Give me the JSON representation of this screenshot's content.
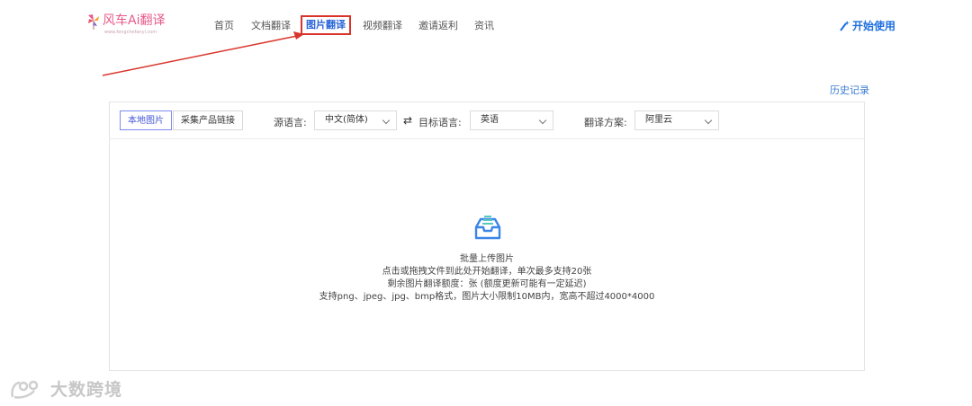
{
  "header": {
    "logo_text": "风车Ai翻译",
    "logo_sub": "www.fengchefanyi.com",
    "nav": [
      {
        "label": "首页",
        "active": false
      },
      {
        "label": "文档翻译",
        "active": false
      },
      {
        "label": "图片翻译",
        "active": true
      },
      {
        "label": "视频翻译",
        "active": false
      },
      {
        "label": "邀请返利",
        "active": false
      },
      {
        "label": "资讯",
        "active": false
      }
    ],
    "start_label": "开始使用",
    "start_icon": "magic-wand-icon"
  },
  "history_label": "历史记录",
  "toolbar": {
    "tabs": [
      {
        "label": "本地图片",
        "active": true
      },
      {
        "label": "采集产品链接",
        "active": false
      }
    ],
    "source_label": "源语言:",
    "source_value": "中文(简体)",
    "swap_icon": "⇄",
    "target_label": "目标语言:",
    "target_value": "英语",
    "plan_label": "翻译方案:",
    "plan_value": "阿里云"
  },
  "dropzone": {
    "icon": "inbox-upload-icon",
    "title": "批量上传图片",
    "line1": "点击或拖拽文件到此处开始翻译，单次最多支持20张",
    "line2": "剩余图片翻译额度：张 (额度更新可能有一定延迟)",
    "line3": "支持png、jpeg、jpg、bmp格式，图片大小限制10MB内，宽高不超过4000*4000"
  },
  "watermark_text": "大数跨境",
  "colors": {
    "accent": "#1f6fe0",
    "highlight_border": "#d9342b",
    "annotation_arrow": "#d9342b",
    "logo": "#e85a8a"
  }
}
